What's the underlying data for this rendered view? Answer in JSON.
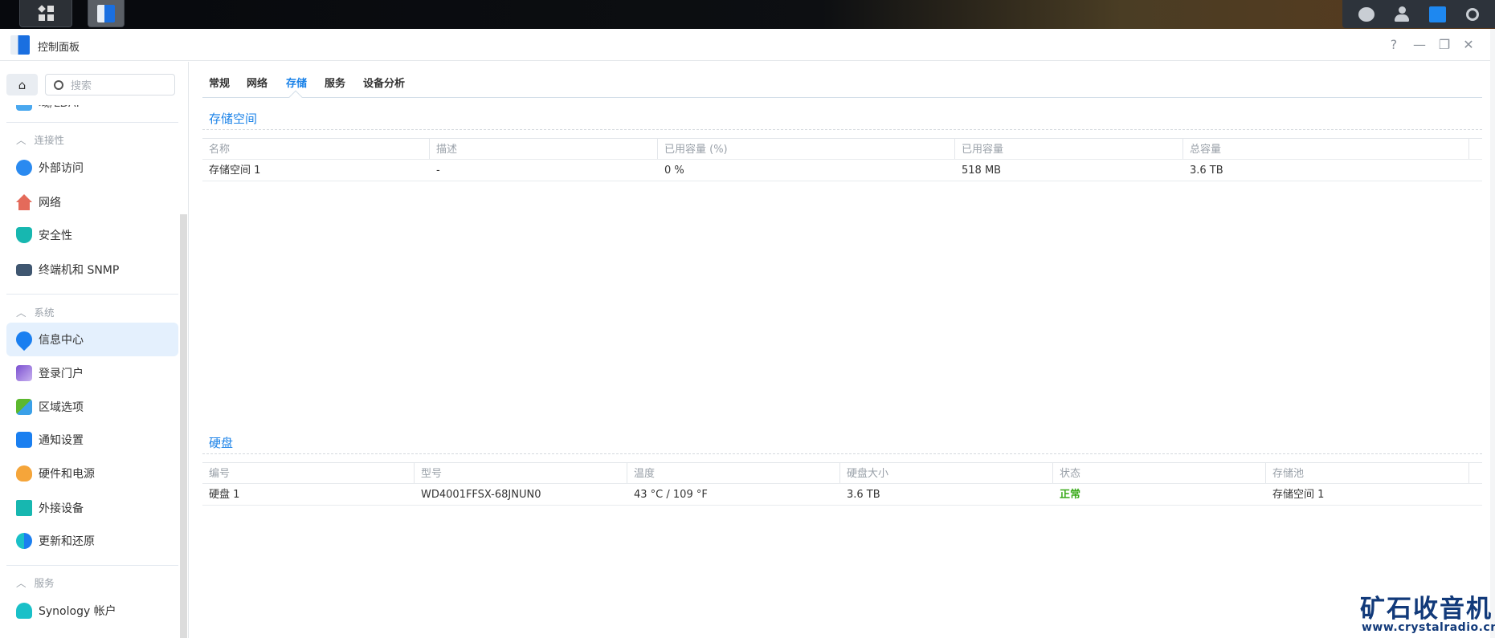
{
  "taskbar": {
    "icons": [
      "main-menu-icon",
      "control-panel-app-icon"
    ],
    "tray": [
      "chat-icon",
      "user-icon",
      "widgets-icon",
      "search-icon"
    ]
  },
  "window": {
    "title": "控制面板",
    "controls": {
      "help": "?",
      "minimize": "—",
      "restore": "❐",
      "close": "✕"
    }
  },
  "sidebar": {
    "search_placeholder": "搜索",
    "partial_top": "域/LDAP",
    "groups": [
      {
        "label": "连接性",
        "items": [
          "外部访问",
          "网络",
          "安全性",
          "终端机和 SNMP"
        ]
      },
      {
        "label": "系统",
        "items": [
          "信息中心",
          "登录门户",
          "区域选项",
          "通知设置",
          "硬件和电源",
          "外接设备",
          "更新和还原"
        ]
      },
      {
        "label": "服务",
        "items": [
          "Synology 帐户"
        ]
      }
    ],
    "active": "信息中心"
  },
  "tabs": [
    {
      "label": "常规"
    },
    {
      "label": "网络"
    },
    {
      "label": "存储",
      "active": true
    },
    {
      "label": "服务"
    },
    {
      "label": "设备分析"
    }
  ],
  "storage": {
    "title": "存储空间",
    "columns": [
      "名称",
      "描述",
      "已用容量 (%)",
      "已用容量",
      "总容量"
    ],
    "rows": [
      [
        "存储空间 1",
        "-",
        "0 %",
        "518 MB",
        "3.6 TB"
      ]
    ]
  },
  "disks": {
    "title": "硬盘",
    "columns": [
      "编号",
      "型号",
      "温度",
      "硬盘大小",
      "状态",
      "存储池"
    ],
    "rows": [
      [
        "硬盘 1",
        "WD4001FFSX-68JNUN0",
        "43 °C / 109 °F",
        "3.6 TB",
        "正常",
        "存储空间 1"
      ]
    ]
  },
  "colors": {
    "accent": "#1a82e8",
    "status_ok": "#3aaa1a",
    "watermark": "#123a7a"
  },
  "watermark": {
    "cn": "矿石收音机",
    "url": "www.crystalradio.cn"
  }
}
